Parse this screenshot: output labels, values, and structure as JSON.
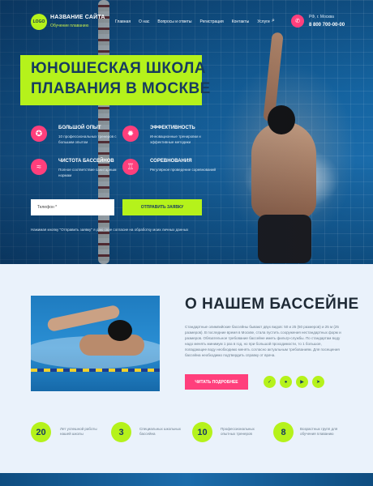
{
  "header": {
    "logo": "LOGO",
    "site_name": "НАЗВАНИЕ САЙТА",
    "site_sub": "Обучение плаванию",
    "nav": [
      "Главная",
      "О нас",
      "Вопросы и ответы",
      "Регистрация",
      "Контакты",
      "Услуги"
    ],
    "city": "РФ, г. Москва",
    "phone": "8 800 700-00-00"
  },
  "hero": {
    "title_line1": "ЮНОШЕСКАЯ ШКОЛА",
    "title_line2": "ПЛАВАНИЯ В МОСКВЕ",
    "features": [
      {
        "icon": "medal-icon",
        "title": "Большой опыт",
        "desc": "10 профессиональных тренеров с большим опытом"
      },
      {
        "icon": "chart-icon",
        "title": "Эффективность",
        "desc": "Инновационные тренировки и эффективные методики"
      },
      {
        "icon": "water-icon",
        "title": "Чистота бассейнов",
        "desc": "Полное соответствие санитарным нормам"
      },
      {
        "icon": "cup-icon",
        "title": "Соревнования",
        "desc": "Регулярное проведение соревнований"
      }
    ],
    "form": {
      "phone_placeholder": "Телефон *",
      "submit_label": "ОТПРАВИТЬ ЗАЯВКУ",
      "consent": "Нажимая кнопку \"Отправить заявку\" я даю свое согласие на обработку моих личных данных"
    }
  },
  "about": {
    "title": "О НАШЕМ БАССЕЙНЕ",
    "text": "Стандартные олимпийские бассейны бывают двух видов: 50 и 25 (50 размеров) и 25 м (25 размеров). В последние время в Москве, стала пустить сооружения нестандартных форм и размеров. Обязательное требование бассейне иметь фильтр-службы. По стандартам воду надо менять минимум 1 раз в год, но при большой проходимости, то 1 большое, попадающее воду необходимо менять согласно актуальным требованиям. Для посещения бассейна необходимо подтвердить справку от врача.",
    "more_label": "ЧИТАТЬ ПОДРОБНЕЕ",
    "socials": [
      "vk-icon",
      "ok-icon",
      "youtube-icon",
      "telegram-icon"
    ]
  },
  "stats": [
    {
      "value": "20",
      "label": "Лет успешной работы нашей школы"
    },
    {
      "value": "3",
      "label": "Специальных школьных бассейна"
    },
    {
      "value": "10",
      "label": "Профессиональных опытных тренеров"
    },
    {
      "value": "8",
      "label": "Возрастных групп для обучения плаванию"
    }
  ],
  "colors": {
    "accent": "#b5f21b",
    "pink": "#ff3f7c",
    "navy": "#163b5f"
  }
}
